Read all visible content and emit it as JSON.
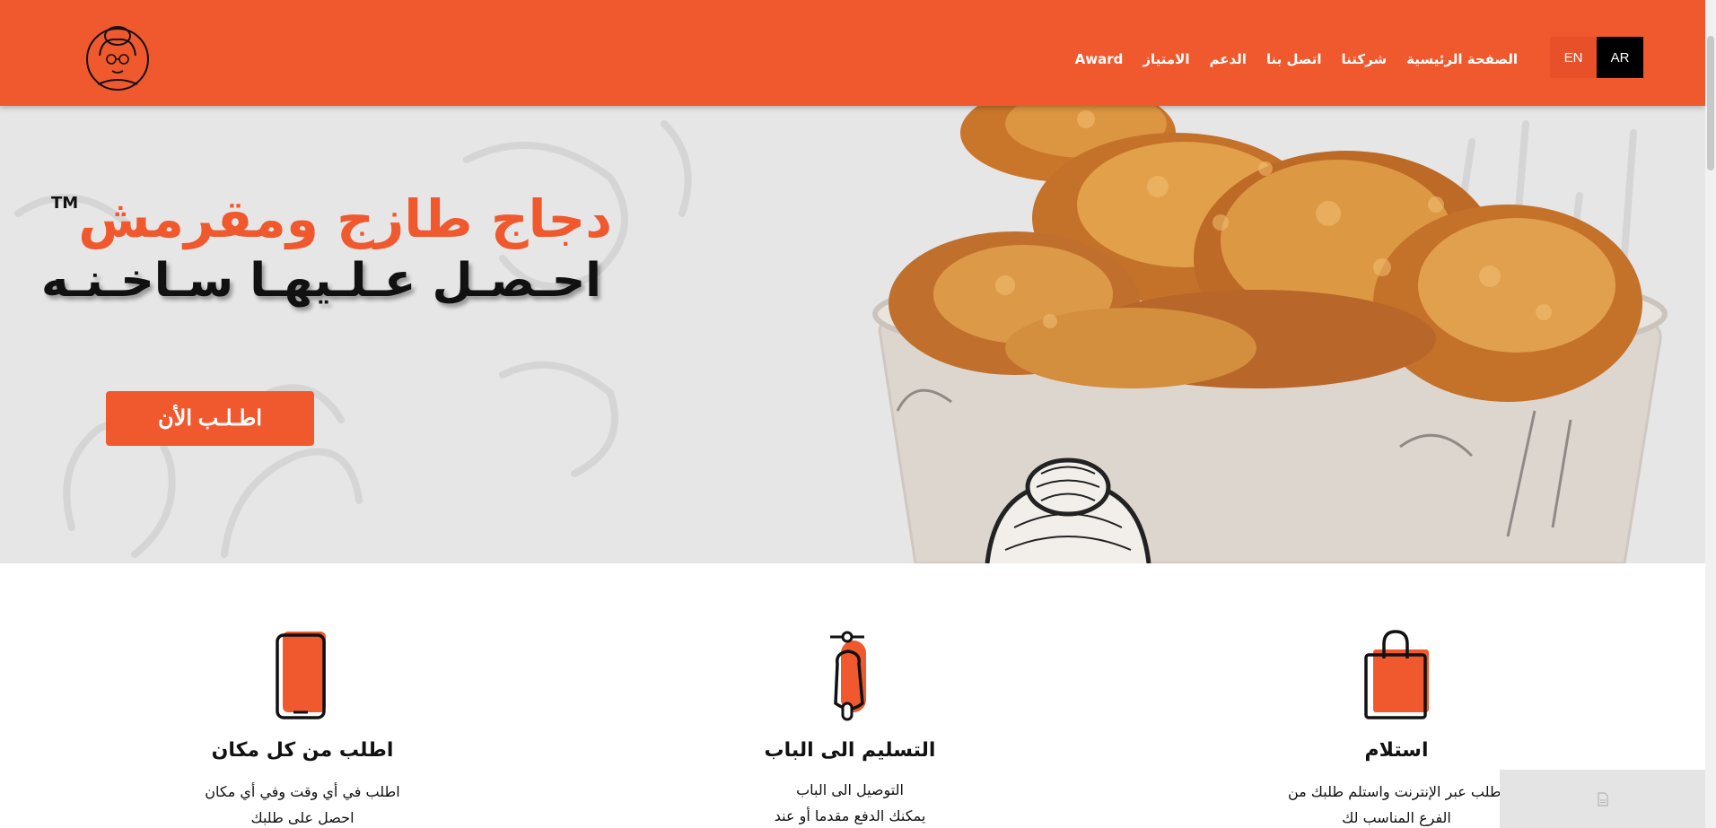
{
  "header": {
    "logo_name": "grandma-logo",
    "nav": [
      "الصفحة الرئيسية",
      "شركتنا",
      "اتصل بنا",
      "الدعم",
      "الامتياز",
      "Award"
    ],
    "lang_ar": "AR",
    "lang_en": "EN"
  },
  "hero": {
    "title": "دجاج طازج ومقرمش",
    "tm": "TM",
    "subtitle": "احـصـل عـلـيهـا سـاخـنـه",
    "order_button": "اطـلـب الأن"
  },
  "features": [
    {
      "icon": "phone-icon",
      "title": "اطلب من كل مكان",
      "lines": [
        "اطلب في أي وقت وفي أي مكان",
        "احصل على طلبك"
      ]
    },
    {
      "icon": "scooter-icon",
      "title": "التسليم الى الباب",
      "lines": [
        "التوصيل الى الباب",
        "يمكنك الدفع مقدما أو عند"
      ]
    },
    {
      "icon": "shopping-bag-icon",
      "title": "استلام",
      "lines": [
        "اطلب عبر الإنترنت واستلم طلبك من",
        "الفرع المناسب لك"
      ]
    }
  ],
  "colors": {
    "brand": "#f0582e",
    "hero_bg": "#e7e6e7",
    "text": "#111111"
  }
}
